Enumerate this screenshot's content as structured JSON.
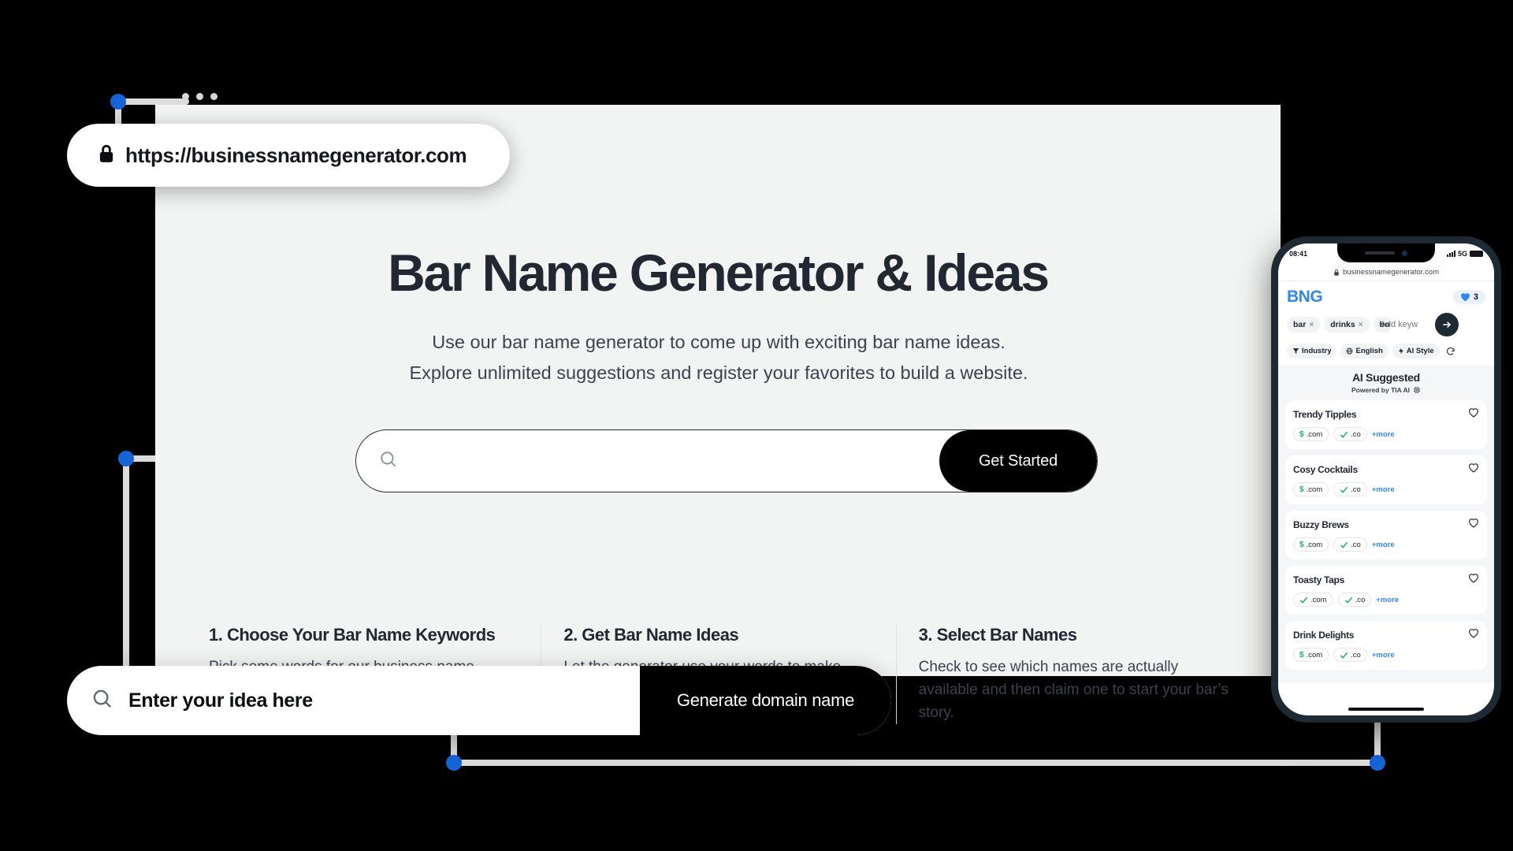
{
  "browser": {
    "url": "https://businessnamegenerator.com",
    "lock_icon": "lock-icon",
    "window_dots": "window-dots"
  },
  "hero": {
    "title": "Bar Name Generator & Ideas",
    "subtitle": "Use our bar name generator to come up with exciting bar name ideas. Explore unlimited suggestions and register your favorites to build a website.",
    "search_placeholder": "",
    "search_value": "",
    "cta_label": "Get Started",
    "search_icon": "search-icon"
  },
  "steps": [
    {
      "title": "1. Choose Your Bar Name Keywords",
      "body": "Pick some words for our business name generator that express your bar’s style or theme."
    },
    {
      "title": "2. Get Bar Name Ideas",
      "body": "Let the generator use your words to make countless great name ideas, and take a look through the results."
    },
    {
      "title": "3. Select Bar Names",
      "body": "Check to see which names are actually available and then claim one to start your bar’s story."
    }
  ],
  "bottom_bar": {
    "placeholder": "Enter your idea here",
    "button_label": "Generate domain name",
    "search_icon": "search-icon"
  },
  "phone": {
    "status": {
      "time": "08:41",
      "network": "5G",
      "signal_icon": "signal-bars-icon",
      "battery_icon": "battery-icon"
    },
    "url": "businessnamegenerator.com",
    "logo": "BNG",
    "favorites_count": "3",
    "heart_icon": "heart-icon",
    "keywords": [
      {
        "label": "bar",
        "remove": "×"
      },
      {
        "label": "drinks",
        "remove": "×"
      },
      {
        "label": "bo",
        "remove": "×"
      }
    ],
    "keyword_input_placeholder": "Add keyw",
    "submit_icon": "arrow-right-icon",
    "filters": [
      {
        "label": "Industry",
        "icon": "filter-icon"
      },
      {
        "label": "English",
        "icon": "globe-icon"
      },
      {
        "label": "AI Style",
        "icon": "bolt-icon"
      }
    ],
    "refresh_icon": "refresh-icon",
    "ai_title": "AI Suggested",
    "ai_subtitle": "Powered by TIA AI",
    "ai_chip_icon": "chip-icon",
    "more_label": "+more",
    "results": [
      {
        "name": "Trendy Tipples",
        "com_state": "paid",
        "com": ".com",
        "co": ".co"
      },
      {
        "name": "Cosy Cocktails",
        "com_state": "paid",
        "com": ".com",
        "co": ".co"
      },
      {
        "name": "Buzzy Brews",
        "com_state": "paid",
        "com": ".com",
        "co": ".co"
      },
      {
        "name": "Toasty Taps",
        "com_state": "free",
        "com": ".com",
        "co": ".co"
      },
      {
        "name": "Drink Delights",
        "com_state": "paid",
        "com": ".com",
        "co": ".co"
      }
    ]
  },
  "colors": {
    "accent_blue": "#1565d8",
    "logo_blue": "#2f86f6",
    "link_blue": "#2f86f6",
    "green": "#21b35a",
    "dark": "#222831",
    "page_bg": "#f2f4f3",
    "black": "#000000"
  }
}
